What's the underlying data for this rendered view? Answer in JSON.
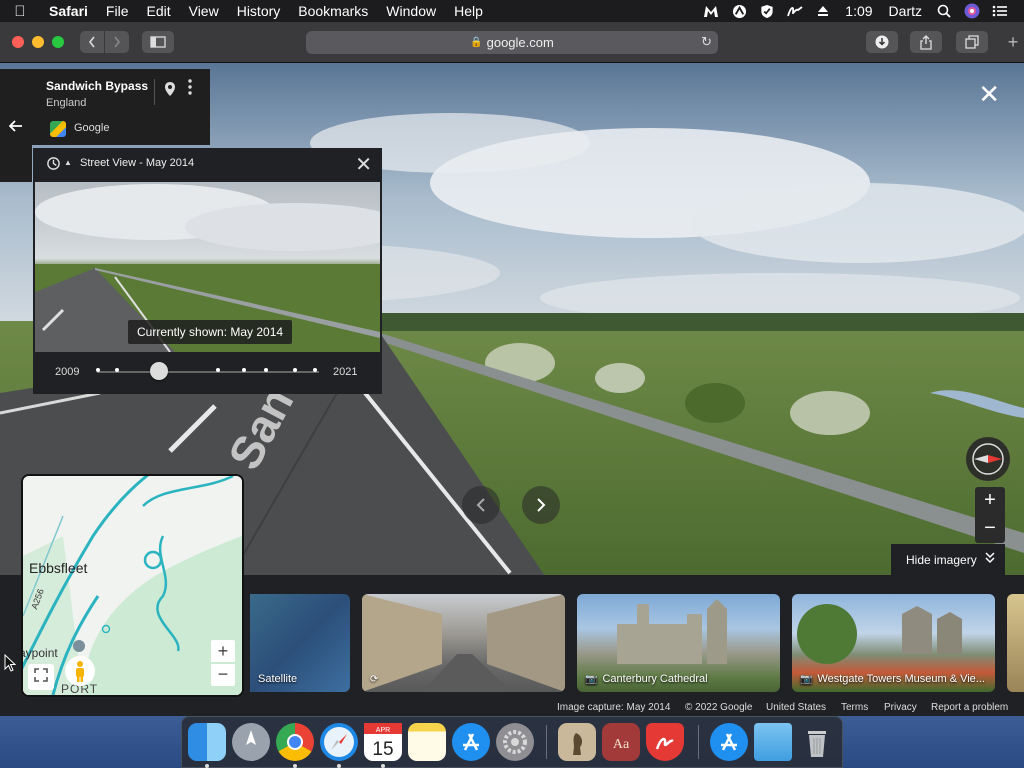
{
  "menubar": {
    "app": "Safari",
    "items": [
      "File",
      "Edit",
      "View",
      "History",
      "Bookmarks",
      "Window",
      "Help"
    ],
    "time": "1:09",
    "user": "Dartz"
  },
  "toolbar": {
    "url": "google.com"
  },
  "place": {
    "title": "Sandwich Bypass",
    "subtitle": "England",
    "source": "Google"
  },
  "timemachine": {
    "title": "Street View - May 2014",
    "currently_shown": "Currently shown: May 2014",
    "year_start": "2009",
    "year_end": "2021",
    "selected_fraction": 0.28
  },
  "imagery": {
    "hide_label": "Hide imagery",
    "thumbs": [
      {
        "caption": "Satellite"
      },
      {
        "caption": ""
      },
      {
        "caption": "Canterbury Cathedral"
      },
      {
        "caption": "Westgate Towers Museum & Vie..."
      }
    ]
  },
  "minimap": {
    "place_label": "Ebbsfleet",
    "road_label": "A256",
    "point_label": "aypoint",
    "port_label": "PORT"
  },
  "footer": {
    "capture": "Image capture: May 2014",
    "copyright": "© 2022 Google",
    "region": "United States",
    "terms": "Terms",
    "privacy": "Privacy",
    "report": "Report a problem"
  },
  "colors": {
    "panel_bg": "#202124",
    "accent_blue": "#1a73e8"
  }
}
